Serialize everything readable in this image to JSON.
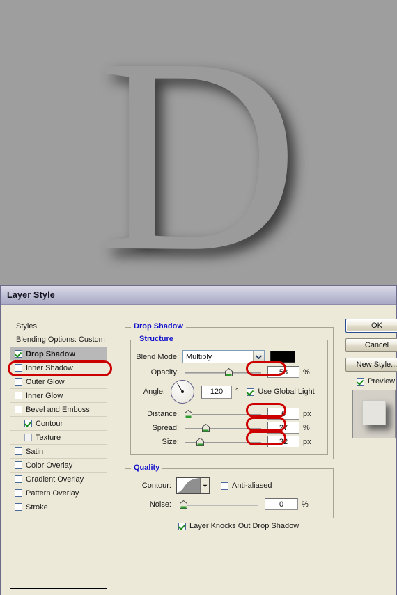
{
  "canvas": {
    "letter": "D",
    "background_color": "#9e9e9e",
    "letter_color": "#9b9b9b",
    "shadow_color": "#1e1e1e"
  },
  "dialog": {
    "title": "Layer Style",
    "styles_panel": {
      "header": "Styles",
      "blending_options": "Blending Options: Custom",
      "items": [
        {
          "label": "Drop Shadow",
          "checked": true,
          "selected": true,
          "sub": false,
          "disabled": false
        },
        {
          "label": "Inner Shadow",
          "checked": false,
          "selected": false,
          "sub": false,
          "disabled": false
        },
        {
          "label": "Outer Glow",
          "checked": false,
          "selected": false,
          "sub": false,
          "disabled": false
        },
        {
          "label": "Inner Glow",
          "checked": false,
          "selected": false,
          "sub": false,
          "disabled": false
        },
        {
          "label": "Bevel and Emboss",
          "checked": false,
          "selected": false,
          "sub": false,
          "disabled": false
        },
        {
          "label": "Contour",
          "checked": true,
          "selected": false,
          "sub": true,
          "disabled": false
        },
        {
          "label": "Texture",
          "checked": false,
          "selected": false,
          "sub": true,
          "disabled": true
        },
        {
          "label": "Satin",
          "checked": false,
          "selected": false,
          "sub": false,
          "disabled": false
        },
        {
          "label": "Color Overlay",
          "checked": false,
          "selected": false,
          "sub": false,
          "disabled": false
        },
        {
          "label": "Gradient Overlay",
          "checked": false,
          "selected": false,
          "sub": false,
          "disabled": false
        },
        {
          "label": "Pattern Overlay",
          "checked": false,
          "selected": false,
          "sub": false,
          "disabled": false
        },
        {
          "label": "Stroke",
          "checked": false,
          "selected": false,
          "sub": false,
          "disabled": false
        }
      ]
    },
    "drop_shadow": {
      "group_label": "Drop Shadow",
      "structure": {
        "group_label": "Structure",
        "blend_mode_label": "Blend Mode:",
        "blend_mode_value": "Multiply",
        "shadow_color": "#000000",
        "opacity_label": "Opacity:",
        "opacity_value": "58",
        "opacity_unit": "%",
        "angle_label": "Angle:",
        "angle_value": "120",
        "angle_unit": "°",
        "use_global_light_label": "Use Global Light",
        "use_global_light_checked": true,
        "distance_label": "Distance:",
        "distance_value": "6",
        "distance_unit": "px",
        "spread_label": "Spread:",
        "spread_value": "27",
        "spread_unit": "%",
        "size_label": "Size:",
        "size_value": "32",
        "size_unit": "px"
      },
      "quality": {
        "group_label": "Quality",
        "contour_label": "Contour:",
        "anti_aliased_label": "Anti-aliased",
        "anti_aliased_checked": false,
        "noise_label": "Noise:",
        "noise_value": "0",
        "noise_unit": "%"
      },
      "knockout_label": "Layer Knocks Out Drop Shadow",
      "knockout_checked": true
    },
    "buttons": {
      "ok": "OK",
      "cancel": "Cancel",
      "new_style": "New Style...",
      "preview_label": "Preview",
      "preview_checked": true
    },
    "annotation_color": "#cc0000"
  }
}
